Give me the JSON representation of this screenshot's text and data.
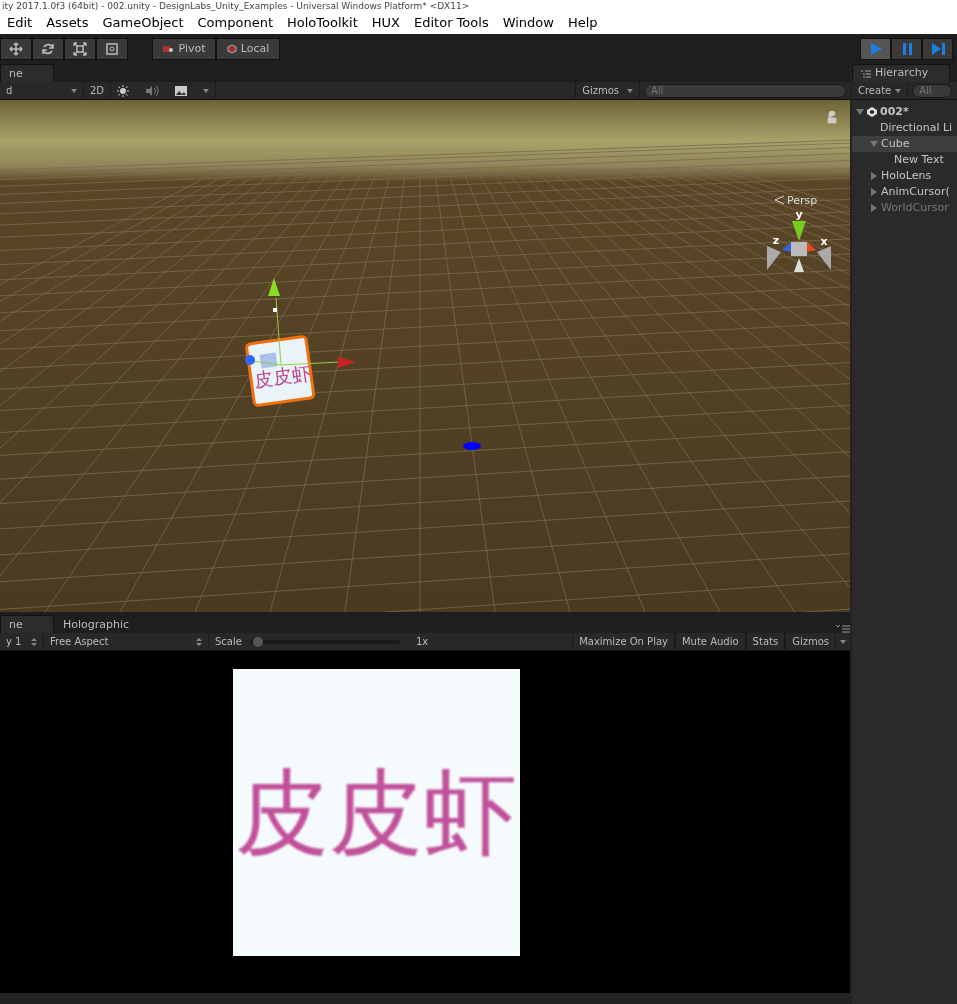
{
  "window": {
    "title": "ity 2017.1.0f3 (64bit) - 002.unity - DesignLabs_Unity_Examples - Universal Windows Platform* <DX11>"
  },
  "menu": [
    "Edit",
    "Assets",
    "GameObject",
    "Component",
    "HoloToolkit",
    "HUX",
    "Editor Tools",
    "Window",
    "Help"
  ],
  "toolbar": {
    "pivot": "Pivot",
    "local": "Local"
  },
  "scene": {
    "tab": "ne",
    "shading": "d",
    "mode_2d": "2D",
    "gizmos": "Gizmos",
    "search_placeholder": "All",
    "axis_labels": [
      "y",
      "z",
      "x"
    ],
    "projection": "Persp",
    "cube_text": "皮皮虾"
  },
  "game": {
    "tabs": [
      {
        "label": "ne",
        "selected": true
      },
      {
        "label": "Holographic",
        "selected": false
      }
    ],
    "display": "y 1",
    "aspect": "Free Aspect",
    "scale_label": "Scale",
    "scale": {
      "level": 0.02
    },
    "scale_reading": "1x",
    "buttons": [
      "Maximize On Play",
      "Mute Audio",
      "Stats",
      "Gizmos"
    ],
    "card_text": "皮皮虾"
  },
  "hierarchy": {
    "tab": "Hierarchy",
    "create": "Create",
    "search_placeholder": "All",
    "tree": [
      {
        "label": "002*",
        "expanded": true,
        "selected": false,
        "disabled": false,
        "children": [
          {
            "label": "Directional Li",
            "selected": false,
            "disabled": false
          },
          {
            "label": "Cube",
            "expanded": true,
            "selected": true,
            "disabled": false,
            "children": [
              {
                "label": "New Text",
                "selected": false,
                "disabled": false
              }
            ]
          },
          {
            "label": "HoloLens",
            "expanded": false,
            "selected": false,
            "disabled": false
          },
          {
            "label": "AnimCursor(",
            "expanded": false,
            "selected": false,
            "disabled": false
          },
          {
            "label": "WorldCursor",
            "expanded": false,
            "selected": false,
            "disabled": true
          }
        ]
      }
    ]
  }
}
